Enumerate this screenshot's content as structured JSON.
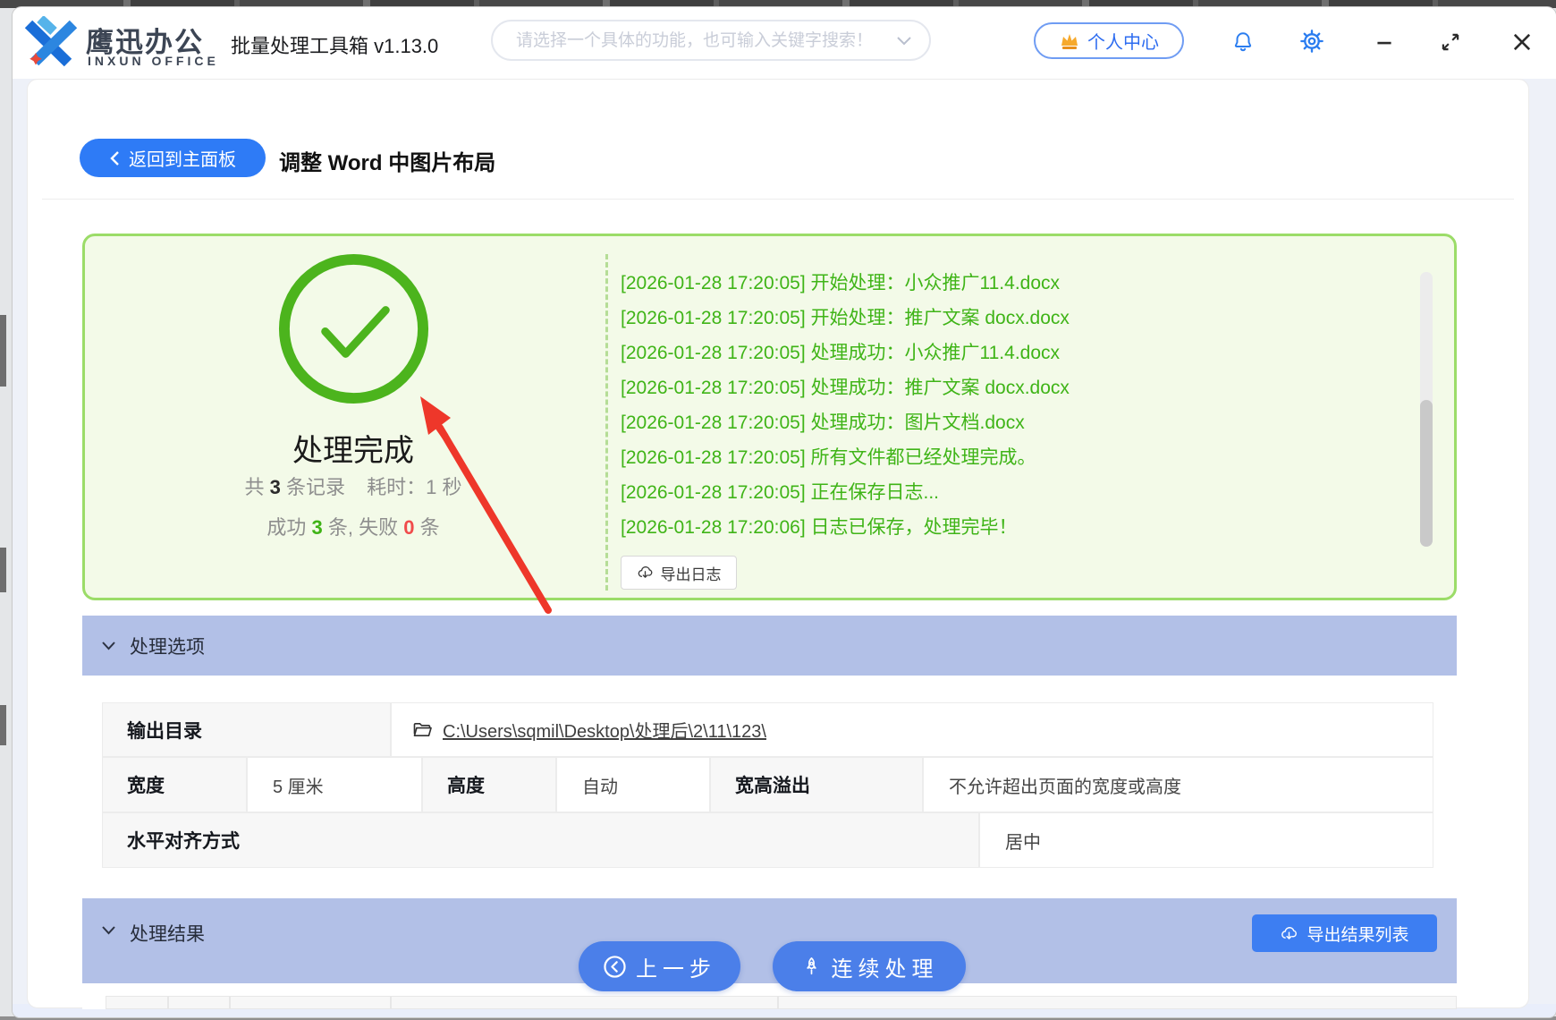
{
  "colors": {
    "accent_blue": "#2e7bf6",
    "pill_blue": "#4b7fe9",
    "band_periwinkle": "#b2c0e7",
    "success_green": "#4cb41d",
    "log_green": "#3fb417",
    "panel_bg": "#f3fae8",
    "panel_border": "#9bdc68",
    "fail_red": "#f04b4b",
    "arrow_red": "#ee372a"
  },
  "header": {
    "brand_cn": "鹰迅办公",
    "brand_en": "INXUN OFFICE",
    "app_title": "批量处理工具箱 v1.13.0",
    "search_placeholder": "请选择一个具体的功能，也可输入关键字搜索！",
    "user_center_label": "个人中心"
  },
  "toolbar": {
    "back_label": "返回到主面板",
    "page_title": "调整 Word 中图片布局"
  },
  "result_panel": {
    "status_title": "处理完成",
    "stats": {
      "total_prefix": "共",
      "total_count": "3",
      "total_suffix": "条记录",
      "time_text": "耗时：1 秒",
      "success_label": "成功",
      "success_count": "3",
      "mid_text": "条, 失败",
      "fail_count": "0",
      "fail_suffix": "条"
    },
    "logs": [
      "[2026-01-28 17:20:05] 开始处理：小众推广11.4.docx",
      "[2026-01-28 17:20:05] 开始处理：推广文案 docx.docx",
      "[2026-01-28 17:20:05] 处理成功：小众推广11.4.docx",
      "[2026-01-28 17:20:05] 处理成功：推广文案 docx.docx",
      "[2026-01-28 17:20:05] 处理成功：图片文档.docx",
      "[2026-01-28 17:20:05] 所有文件都已经处理完成。",
      "[2026-01-28 17:20:05] 正在保存日志...",
      "[2026-01-28 17:20:06] 日志已保存，处理完毕！"
    ],
    "export_log_label": "导出日志"
  },
  "options_section": {
    "title": "处理选项",
    "output_dir_label": "输出目录",
    "output_dir_path": "C:\\Users\\sqmil\\Desktop\\处理后\\2\\11\\123\\",
    "width_label": "宽度",
    "width_value": "5 厘米",
    "height_label": "高度",
    "height_value": "自动",
    "overflow_label": "宽高溢出",
    "overflow_value": "不允许超出页面的宽度或高度",
    "align_label": "水平对齐方式",
    "align_value": "居中"
  },
  "results_section": {
    "title": "处理结果",
    "export_results_label": "导出结果列表"
  },
  "actions": {
    "prev_label": "上一步",
    "continue_label": "连续处理"
  }
}
